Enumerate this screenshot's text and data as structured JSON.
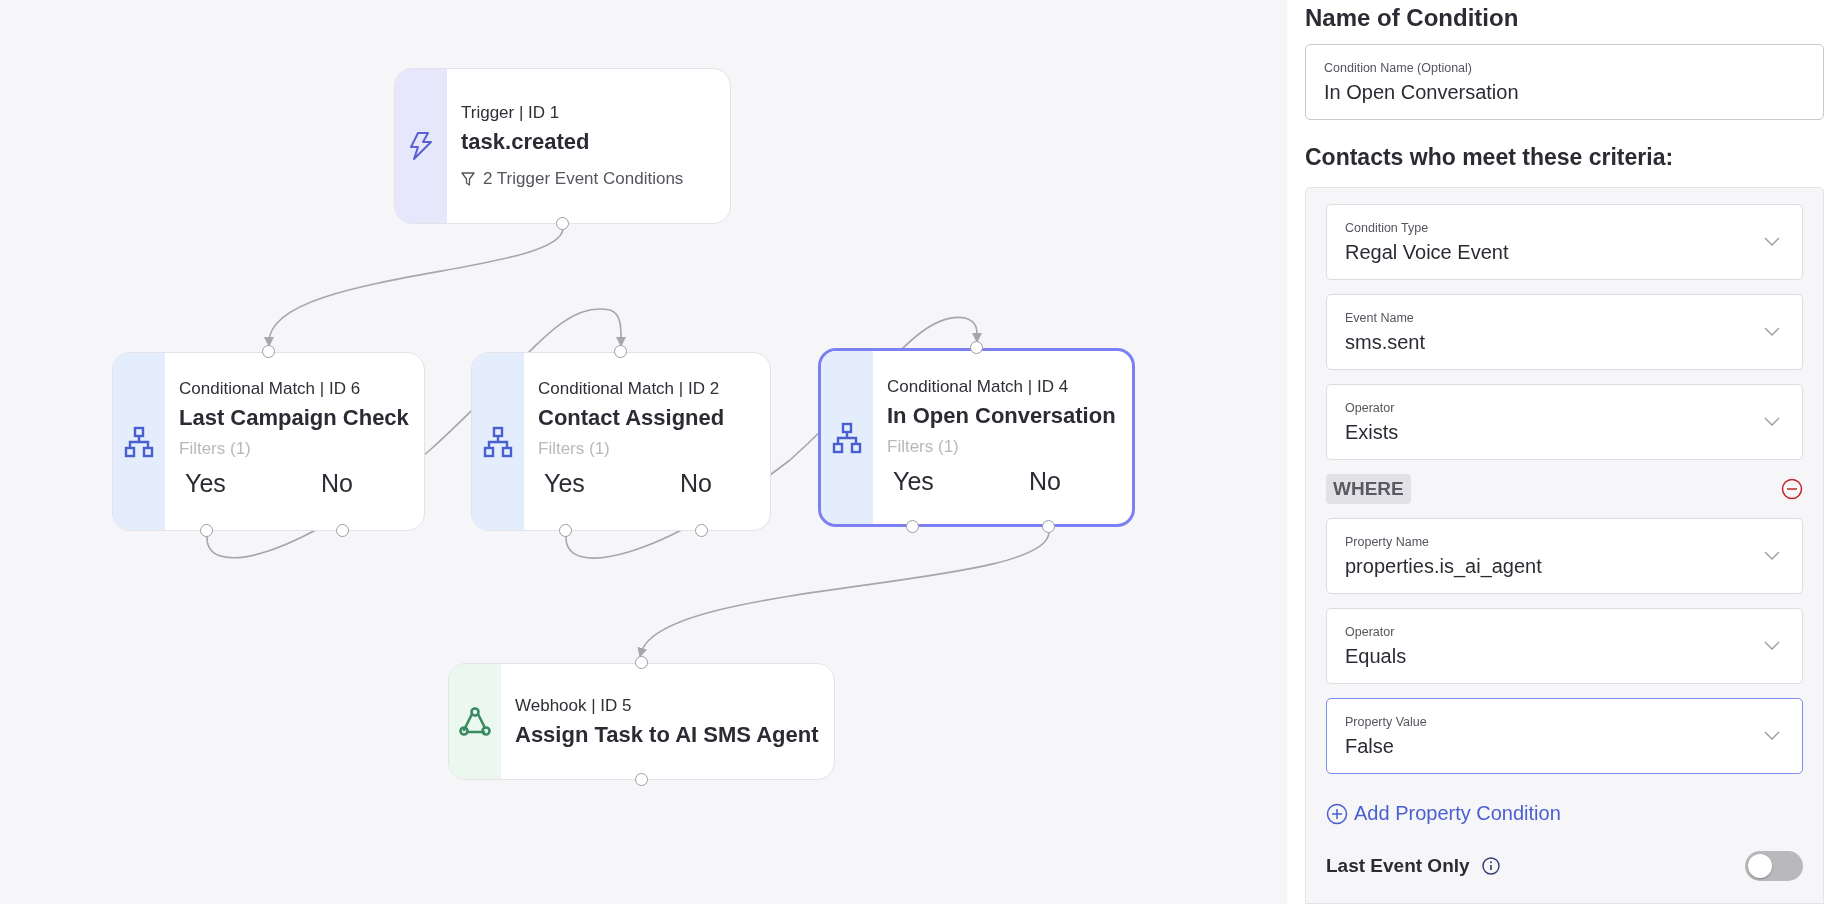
{
  "canvas": {
    "nodes": [
      {
        "kind": "trigger",
        "type_label": "Trigger | ID 1",
        "title": "task.created",
        "conditions": "2 Trigger Event Conditions",
        "selected": false
      },
      {
        "kind": "conditional",
        "type_label": "Conditional Match | ID 6",
        "title": "Last Campaign Check",
        "filters": "Filters (1)",
        "yes": "Yes",
        "no": "No",
        "selected": false
      },
      {
        "kind": "conditional",
        "type_label": "Conditional Match | ID 2",
        "title": "Contact Assigned",
        "filters": "Filters (1)",
        "yes": "Yes",
        "no": "No",
        "selected": false
      },
      {
        "kind": "conditional",
        "type_label": "Conditional Match | ID 4",
        "title": "In Open Conversation",
        "filters": "Filters (1)",
        "yes": "Yes",
        "no": "No",
        "selected": true
      },
      {
        "kind": "webhook",
        "type_label": "Webhook | ID 5",
        "title": "Assign Task to AI SMS Agent",
        "selected": false
      }
    ]
  },
  "panel": {
    "heading": "Name of Condition",
    "name_field": {
      "label": "Condition Name (Optional)",
      "value": "In Open Conversation"
    },
    "criteria_heading": "Contacts who meet these criteria:",
    "fields": [
      {
        "label": "Condition Type",
        "value": "Regal Voice Event",
        "focused": false
      },
      {
        "label": "Event Name",
        "value": "sms.sent",
        "focused": false
      },
      {
        "label": "Operator",
        "value": "Exists",
        "focused": false
      }
    ],
    "where": "WHERE",
    "property_fields": [
      {
        "label": "Property Name",
        "value": "properties.is_ai_agent",
        "focused": false
      },
      {
        "label": "Operator",
        "value": "Equals",
        "focused": false
      },
      {
        "label": "Property Value",
        "value": "False",
        "focused": true
      }
    ],
    "add_button": "Add Property Condition",
    "last_event": {
      "label": "Last Event Only",
      "on": false
    }
  }
}
